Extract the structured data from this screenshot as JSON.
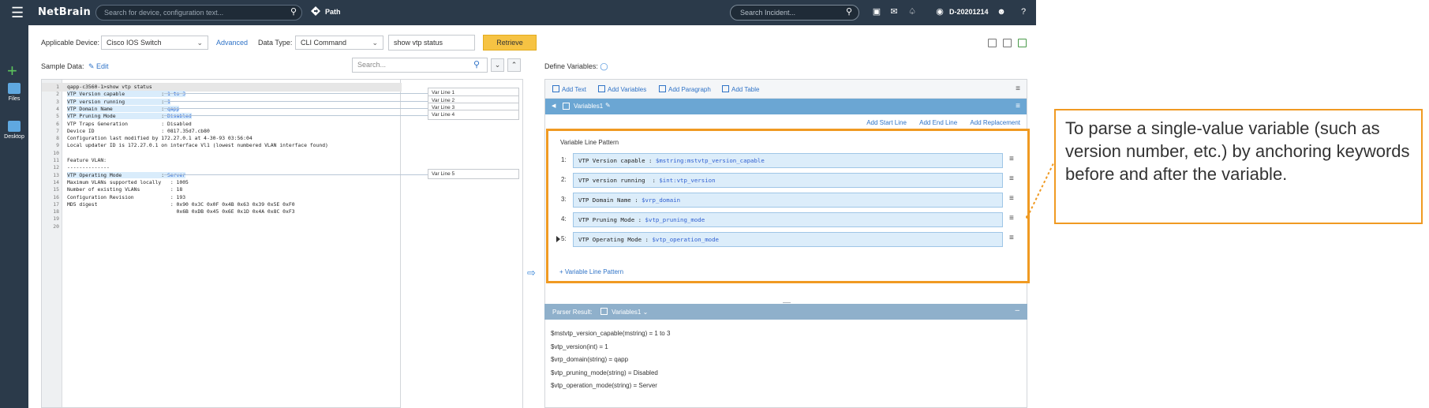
{
  "topbar": {
    "logo": "NetBrain",
    "search_placeholder": "Search for device, configuration text...",
    "path_label": "Path",
    "incident_placeholder": "Search Incident...",
    "domain": "D-20201214"
  },
  "rail": {
    "files_label": "Files",
    "desktop_label": "Desktop"
  },
  "toolbar": {
    "applicable_device_label": "Applicable Device:",
    "applicable_device_value": "Cisco IOS Switch",
    "advanced_link": "Advanced",
    "data_type_label": "Data Type:",
    "data_type_value": "CLI Command",
    "command_value": "show vtp status",
    "retrieve_label": "Retrieve"
  },
  "sample": {
    "label": "Sample Data:",
    "edit_link": "Edit",
    "search_placeholder": "Search...",
    "lines": [
      {
        "n": "1",
        "key": "qapp-c3560-1>show vtp status",
        "value": "",
        "hl": false,
        "cur": true
      },
      {
        "n": "2",
        "key": "VTP Version capable            : ",
        "value": "1 to 3",
        "hl": true,
        "cur": false
      },
      {
        "n": "3",
        "key": "VTP version running            : ",
        "value": "1",
        "hl": true,
        "cur": false
      },
      {
        "n": "4",
        "key": "VTP Domain Name                : ",
        "value": "qapp",
        "hl": true,
        "cur": false
      },
      {
        "n": "5",
        "key": "VTP Pruning Mode               : ",
        "value": "Disabled",
        "hl": true,
        "cur": false
      },
      {
        "n": "6",
        "key": "VTP Traps Generation           : Disabled",
        "value": "",
        "hl": false,
        "cur": false
      },
      {
        "n": "7",
        "key": "Device ID                      : 0817.35d7.cb80",
        "value": "",
        "hl": false,
        "cur": false
      },
      {
        "n": "8",
        "key": "Configuration last modified by 172.27.0.1 at 4-30-93 03:56:04",
        "value": "",
        "hl": false,
        "cur": false
      },
      {
        "n": "9",
        "key": "Local updater ID is 172.27.0.1 on interface Vl1 (lowest numbered VLAN interface found)",
        "value": "",
        "hl": false,
        "cur": false
      },
      {
        "n": "10",
        "key": "",
        "value": "",
        "hl": false,
        "cur": false
      },
      {
        "n": "11",
        "key": "Feature VLAN:",
        "value": "",
        "hl": false,
        "cur": false
      },
      {
        "n": "12",
        "key": "--------------",
        "value": "",
        "hl": false,
        "cur": false
      },
      {
        "n": "13",
        "key": "VTP Operating Mode             : ",
        "value": "Server",
        "hl": true,
        "cur": false
      },
      {
        "n": "14",
        "key": "Maximum VLANs supported locally   : 1005",
        "value": "",
        "hl": false,
        "cur": false
      },
      {
        "n": "15",
        "key": "Number of existing VLANs          : 18",
        "value": "",
        "hl": false,
        "cur": false
      },
      {
        "n": "16",
        "key": "Configuration Revision            : 193",
        "value": "",
        "hl": false,
        "cur": false
      },
      {
        "n": "17",
        "key": "MD5 digest                        : 0x90 0x3C 0x0F 0x4B 0x63 0x39 0x5E 0xF0",
        "value": "",
        "hl": false,
        "cur": false
      },
      {
        "n": "18",
        "key": "                                    0x6B 0xDB 0x45 0x6E 0x1D 0x4A 0x8C 0xF3",
        "value": "",
        "hl": false,
        "cur": false
      },
      {
        "n": "19",
        "key": "",
        "value": "",
        "hl": false,
        "cur": false
      },
      {
        "n": "20",
        "key": "",
        "value": "",
        "hl": false,
        "cur": false
      }
    ],
    "var_lines": [
      "Var Line 1",
      "Var Line 2",
      "Var Line 3",
      "Var Line 4",
      "Var Line 5"
    ]
  },
  "define": {
    "label": "Define Variables:",
    "tools": [
      "Add Text",
      "Add Variables",
      "Add Paragraph",
      "Add Table"
    ],
    "variable_name": "Variables1",
    "line_actions": [
      "Add Start Line",
      "Add End Line",
      "Add Replacement"
    ],
    "pattern_title": "Variable Line Pattern",
    "patterns": [
      {
        "num": "1:",
        "text": "VTP Version capable : ",
        "var": "$mstring:mstvtp_version_capable"
      },
      {
        "num": "2:",
        "text": "VTP version running  : ",
        "var": "$int:vtp_version"
      },
      {
        "num": "3:",
        "text": "VTP Domain Name : ",
        "var": "$vrp_domain"
      },
      {
        "num": "4:",
        "text": "VTP Pruning Mode : ",
        "var": "$vtp_pruning_mode"
      },
      {
        "num": "5:",
        "text": "VTP Operating Mode : ",
        "var": "$vtp_operation_mode"
      }
    ],
    "add_pattern": "+ Variable Line Pattern"
  },
  "parser": {
    "label": "Parser Result:",
    "variable": "Variables1",
    "results": [
      "$mstvtp_version_capable(mstring)  =  1 to 3",
      "$vtp_version(int)  =  1",
      "$vrp_domain(string)  =  qapp",
      "$vtp_pruning_mode(string)  =  Disabled",
      "$vtp_operation_mode(string)  =  Server"
    ]
  },
  "callout": {
    "text": "To parse a single-value variable (such as version number, etc.) by anchoring keywords before and after the variable."
  },
  "colors": {
    "topbar": "#2b3a4a",
    "accent": "#f09a22",
    "retrieve": "#f6c343",
    "highlight": "#d9ecfb",
    "link": "#2f73c7"
  }
}
